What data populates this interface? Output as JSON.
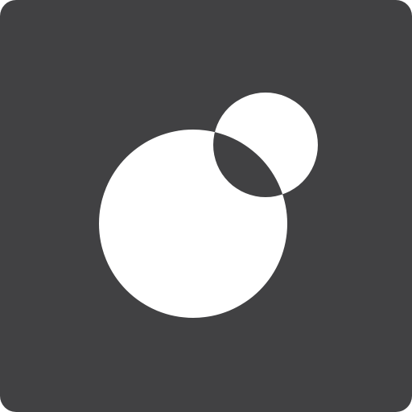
{
  "icon": {
    "name": "overlapping-circles-app-icon",
    "tile_color": "#414143",
    "shape_color": "#ffffff",
    "overlap_color": "#414143"
  }
}
